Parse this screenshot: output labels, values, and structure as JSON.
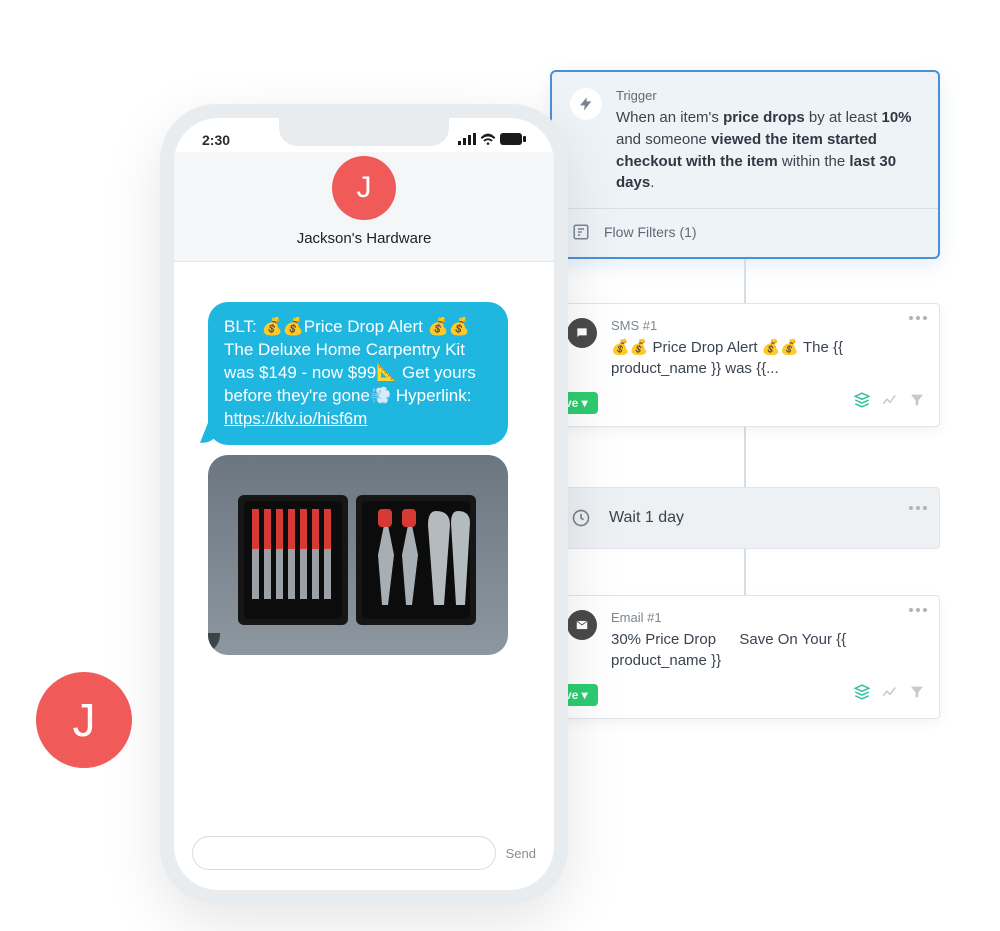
{
  "phone": {
    "time": "2:30",
    "avatar_letter": "J",
    "contact_name": "Jackson's Hardware",
    "sms_text_pre": "BLT: 💰💰Price Drop Alert 💰💰 The Deluxe Home Carpentry Kit was $149 - now $99📐 Get yours before they're gone💨 Hyperlink: ",
    "sms_link": "https://klv.io/hisf6m",
    "send_label": "Send"
  },
  "floating_avatar_letter": "J",
  "flow": {
    "trigger": {
      "label": "Trigger",
      "pre1": "When an item's ",
      "b1": "price drops",
      "mid1": " by at least ",
      "b2": "10%",
      "mid2": " and someone ",
      "b3": "viewed the item",
      "mid3": " ",
      "b4": "started checkout with the item",
      "mid4": " within the ",
      "b5": "last 30 days",
      "post": ".",
      "filters_label": "Flow Filters (1)"
    },
    "sms_card": {
      "label": "SMS #1",
      "text": "💰💰 Price Drop Alert 💰💰 The {{ product_name }} was {{...",
      "live": "ve ▾"
    },
    "wait_card": {
      "text": "Wait 1 day"
    },
    "email_card": {
      "label": "Email #1",
      "text": "30% Price Drop   Save On Your {{ product_name }}",
      "live": "ve ▾"
    }
  }
}
